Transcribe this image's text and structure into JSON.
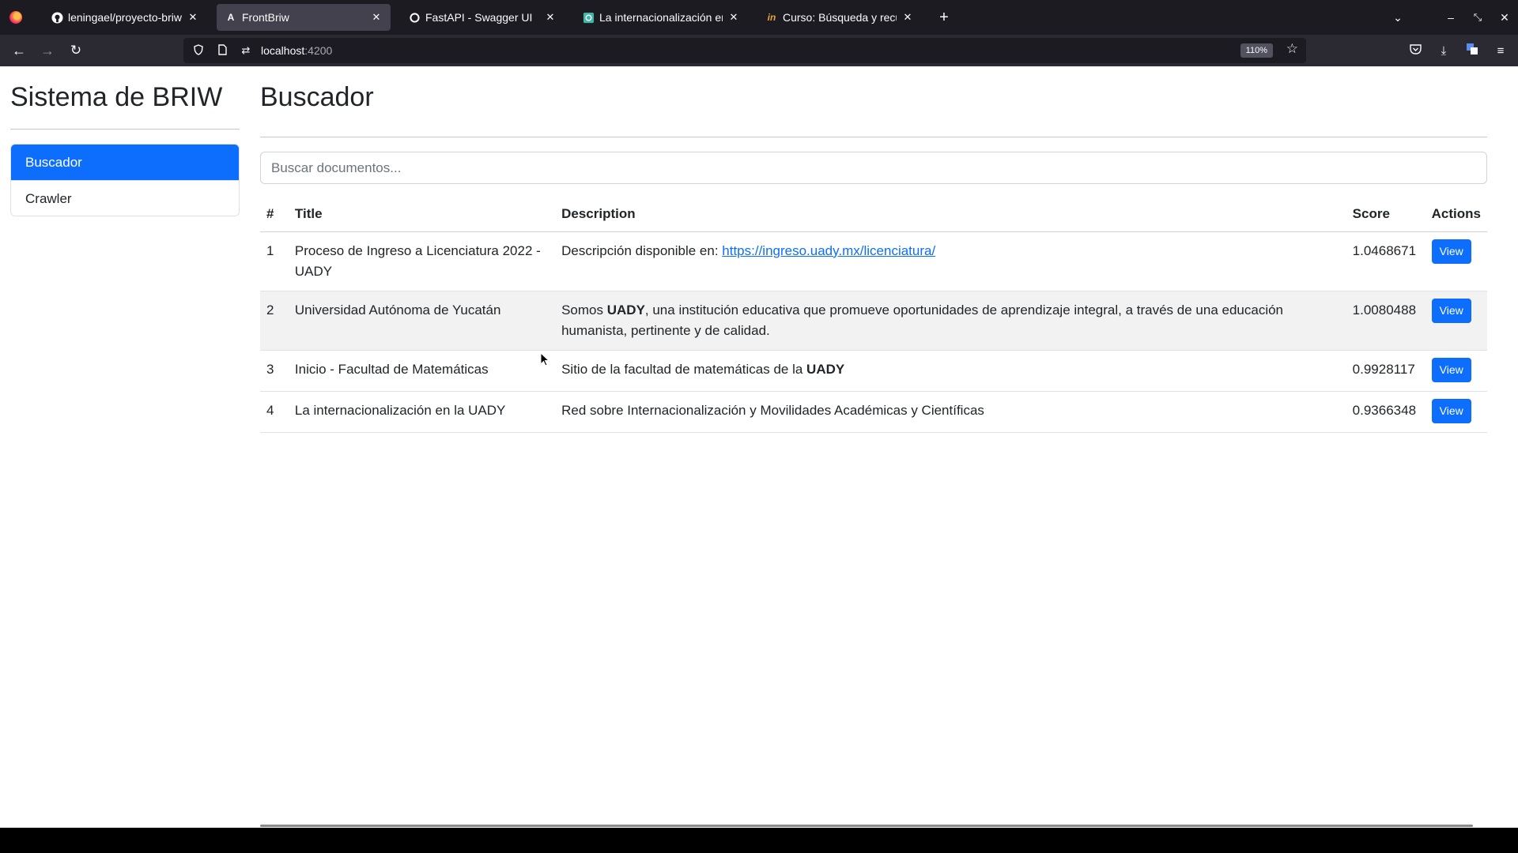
{
  "browser": {
    "tabs": [
      {
        "title": "leningael/proyecto-briw a",
        "favicon": "github-icon"
      },
      {
        "title": "FrontBriw",
        "favicon": "angular-icon",
        "active": true
      },
      {
        "title": "FastAPI - Swagger UI",
        "favicon": "fastapi-icon"
      },
      {
        "title": "La internacionalización en",
        "favicon": "site-icon"
      },
      {
        "title": "Curso: Búsqueda y recupe",
        "favicon": "course-icon"
      }
    ],
    "url_host": "localhost",
    "url_port": ":4200",
    "zoom": "110%"
  },
  "sidebar": {
    "title": "Sistema de BRIW",
    "items": [
      {
        "label": "Buscador",
        "active": true
      },
      {
        "label": "Crawler",
        "active": false
      }
    ]
  },
  "main": {
    "title": "Buscador",
    "search_placeholder": "Buscar documentos..."
  },
  "table": {
    "headers": {
      "num": "#",
      "title": "Title",
      "description": "Description",
      "score": "Score",
      "actions": "Actions"
    },
    "view_label": "View",
    "rows": [
      {
        "num": "1",
        "title": "Proceso de Ingreso a Licenciatura 2022 - UADY",
        "desc_text": "Descripción disponible en: ",
        "desc_link": "https://ingreso.uady.mx/licenciatura/",
        "score": "1.0468671"
      },
      {
        "num": "2",
        "title": "Universidad Autónoma de Yucatán",
        "desc_pre": "Somos ",
        "desc_bold": "UADY",
        "desc_post": ", una institución educativa que promueve oportunidades de aprendizaje integral, a través de una educación humanista, pertinente y de calidad.",
        "score": "1.0080488"
      },
      {
        "num": "3",
        "title": "Inicio - Facultad de Matemáticas",
        "desc_pre": "Sitio de la facultad de matemáticas de la ",
        "desc_bold": "UADY",
        "score": "0.9928117"
      },
      {
        "num": "4",
        "title": "La internacionalización en la UADY",
        "desc_text": "Red sobre Internacionalización y Movilidades Académicas y Científicas",
        "score": "0.9366348"
      }
    ]
  },
  "colors": {
    "primary": "#0d6efd",
    "chrome_dark": "#1c1b22",
    "chrome_mid": "#2b2a33"
  }
}
